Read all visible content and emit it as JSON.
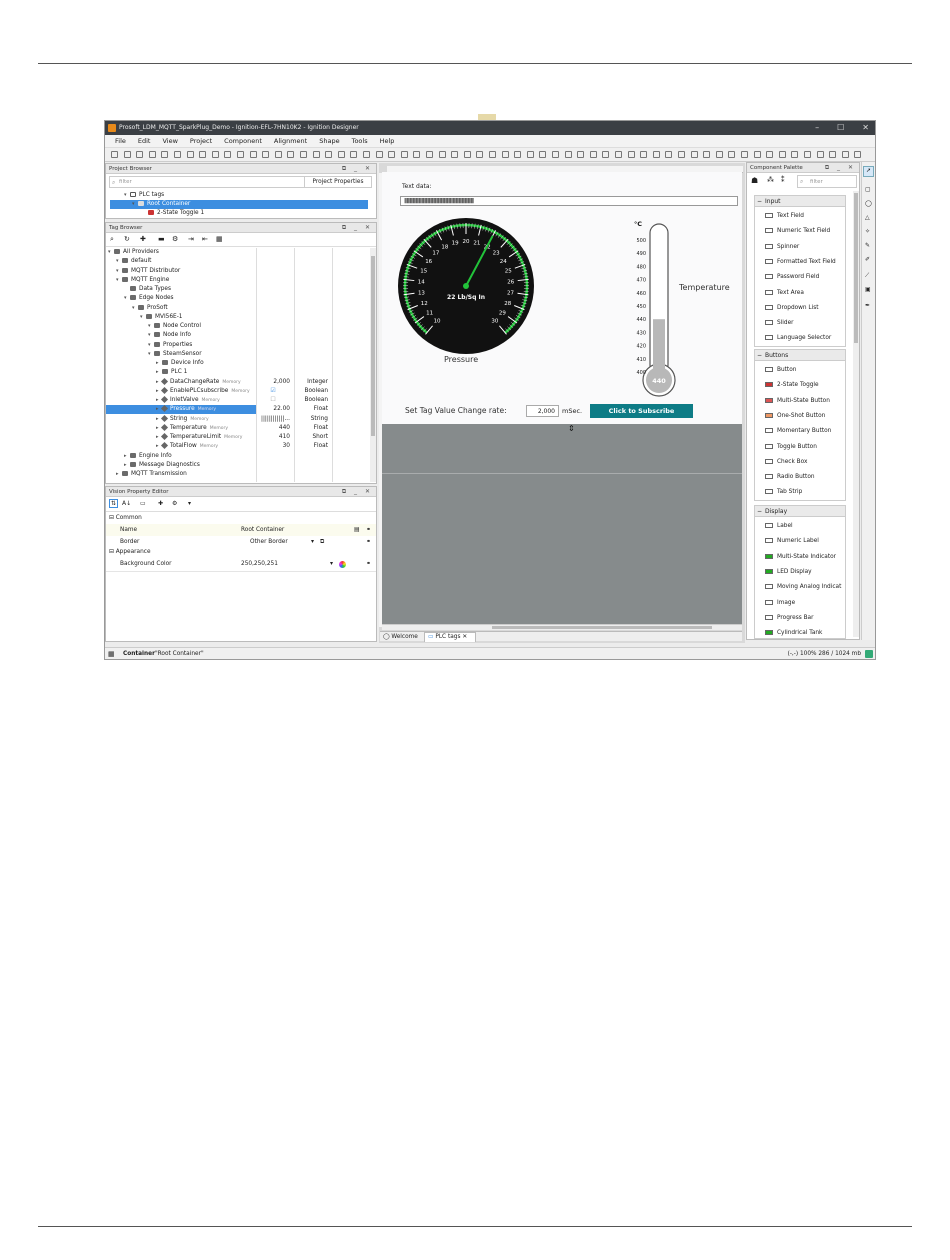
{
  "window": {
    "title": "Prosoft_LDM_MQTT_SparkPlug_Demo - Ignition-EFL-7HN10K2 - Ignition Designer"
  },
  "menu": [
    "File",
    "Edit",
    "View",
    "Project",
    "Component",
    "Alignment",
    "Shape",
    "Tools",
    "Help"
  ],
  "project_browser": {
    "title": "Project Browser",
    "filter_placeholder": "filter",
    "properties_btn": "Project Properties",
    "items": [
      "PLC tags",
      "Root Container",
      "2-State Toggle 1"
    ]
  },
  "tag_browser": {
    "title": "Tag Browser",
    "rows": [
      {
        "label": "All Providers",
        "indent": 0,
        "kind": "folder"
      },
      {
        "label": "default",
        "indent": 1,
        "kind": "folder"
      },
      {
        "label": "MQTT Distributor",
        "indent": 1,
        "kind": "folder"
      },
      {
        "label": "MQTT Engine",
        "indent": 1,
        "kind": "folder"
      },
      {
        "label": "Data Types",
        "indent": 2,
        "kind": "folder"
      },
      {
        "label": "Edge Nodes",
        "indent": 2,
        "kind": "folder"
      },
      {
        "label": "ProSoft",
        "indent": 3,
        "kind": "folder"
      },
      {
        "label": "MVI56E-1",
        "indent": 4,
        "kind": "folder"
      },
      {
        "label": "Node Control",
        "indent": 5,
        "kind": "folder"
      },
      {
        "label": "Node Info",
        "indent": 5,
        "kind": "folder"
      },
      {
        "label": "Properties",
        "indent": 5,
        "kind": "folder"
      },
      {
        "label": "SteamSensor",
        "indent": 5,
        "kind": "folder"
      },
      {
        "label": "Device Info",
        "indent": 6,
        "kind": "folder"
      },
      {
        "label": "PLC 1",
        "indent": 6,
        "kind": "folder"
      },
      {
        "label": "DataChangeRate",
        "indent": 6,
        "kind": "tag",
        "mem": "Memory",
        "value": "2,000",
        "type": "Integer"
      },
      {
        "label": "EnablePLCsubscribe",
        "indent": 6,
        "kind": "tag",
        "mem": "Memory",
        "value": "☑",
        "type": "Boolean"
      },
      {
        "label": "InletValve",
        "indent": 6,
        "kind": "tag",
        "mem": "Memory",
        "value": "☐",
        "type": "Boolean"
      },
      {
        "label": "Pressure",
        "indent": 6,
        "kind": "tag",
        "mem": "Memory",
        "value": "22.00",
        "type": "Float",
        "selected": true
      },
      {
        "label": "String",
        "indent": 6,
        "kind": "tag",
        "mem": "Memory",
        "value": "||||||||||||...",
        "type": "String"
      },
      {
        "label": "Temperature",
        "indent": 6,
        "kind": "tag",
        "mem": "Memory",
        "value": "440",
        "type": "Float"
      },
      {
        "label": "TemperatureLimit",
        "indent": 6,
        "kind": "tag",
        "mem": "Memory",
        "value": "410",
        "type": "Short"
      },
      {
        "label": "TotalFlow",
        "indent": 6,
        "kind": "tag",
        "mem": "Memory",
        "value": "30",
        "type": "Float"
      },
      {
        "label": "Engine Info",
        "indent": 2,
        "kind": "folder"
      },
      {
        "label": "Message Diagnostics",
        "indent": 2,
        "kind": "folder"
      },
      {
        "label": "MQTT Transmission",
        "indent": 1,
        "kind": "folder"
      }
    ]
  },
  "property_editor": {
    "title": "Vision Property Editor",
    "sections": [
      {
        "name": "Common",
        "rows": [
          {
            "name": "Name",
            "value": "Root Container"
          },
          {
            "name": "Border",
            "value": "Other Border"
          }
        ]
      },
      {
        "name": "Appearance",
        "rows": [
          {
            "name": "Background Color",
            "value": "250,250,251"
          }
        ]
      }
    ]
  },
  "canvas": {
    "text_data_label": "Text data:",
    "text_data_value": "||||||||||||||||||||||||||||||||||||||||||||||||||||||||||||||||||||||||||||||||||||||||||||",
    "gauge": {
      "label": "Pressure",
      "unit": "22 Lb/Sq In",
      "value": 22,
      "min": 10,
      "max": 30,
      "ticks": [
        "10",
        "11",
        "12",
        "13",
        "14",
        "15",
        "16",
        "17",
        "18",
        "19",
        "20",
        "21",
        "22",
        "23",
        "24",
        "25",
        "26",
        "27",
        "28",
        "29",
        "30"
      ]
    },
    "thermo": {
      "unit": "°C",
      "label": "Temperature",
      "value": 440,
      "min": 400,
      "max": 500,
      "value_text": "440",
      "ticks": [
        "500",
        "490",
        "480",
        "470",
        "460",
        "450",
        "440",
        "430",
        "420",
        "410",
        "400"
      ]
    },
    "rate_label": "Set Tag Value Change rate:",
    "rate_value": "2,000",
    "rate_unit": "mSec.",
    "subscribe_btn": "Click to Subscribe"
  },
  "tabs": [
    "Welcome",
    "PLC tags"
  ],
  "palette": {
    "title": "Component Palette",
    "filter_placeholder": "filter",
    "sections": [
      {
        "name": "Input",
        "items": [
          "Text Field",
          "Numeric Text Field",
          "Spinner",
          "Formatted Text Field",
          "Password Field",
          "Text Area",
          "Dropdown List",
          "Slider",
          "Language Selector"
        ]
      },
      {
        "name": "Buttons",
        "items": [
          "Button",
          "2-State Toggle",
          "Multi-State Button",
          "One-Shot Button",
          "Momentary Button",
          "Toggle Button",
          "Check Box",
          "Radio Button",
          "Tab Strip"
        ]
      },
      {
        "name": "Display",
        "items": [
          "Label",
          "Numeric Label",
          "Multi-State Indicator",
          "LED Display",
          "Moving Analog Indicat",
          "Image",
          "Progress Bar",
          "Cylindrical Tank"
        ]
      }
    ]
  },
  "status": {
    "type": "Container",
    "name": "\"Root Container\"",
    "right": "(-,-) 100% 286 / 1024 mb"
  },
  "colors": {
    "accent": "#3d8ee0",
    "button": "#0e7c86",
    "gauge_green": "#22c33a"
  }
}
